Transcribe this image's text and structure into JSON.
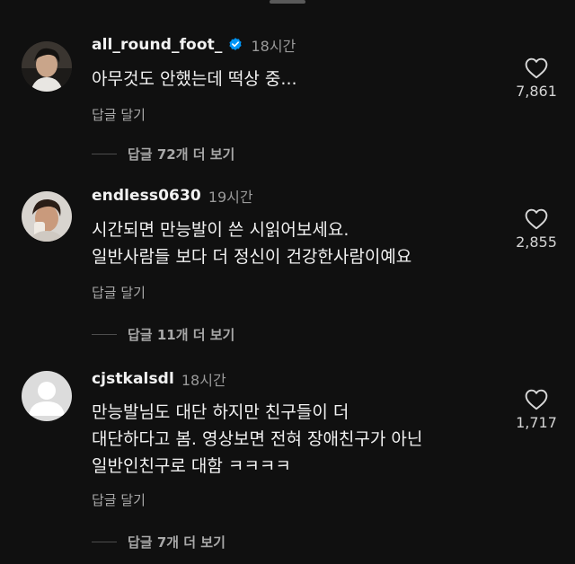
{
  "comments": [
    {
      "username": "all_round_foot_",
      "verified": true,
      "time": "18시간",
      "body": "아무것도 안했는데 떡상 중...",
      "reply_label": "답글 달기",
      "likes": "7,861",
      "view_replies": "답글 72개 더 보기"
    },
    {
      "username": "endless0630",
      "verified": false,
      "time": "19시간",
      "body": "시간되면 만능발이 쓴 시읽어보세요.\n일반사람들 보다 더 정신이 건강한사람이예요",
      "reply_label": "답글 달기",
      "likes": "2,855",
      "view_replies": "답글 11개 더 보기"
    },
    {
      "username": "cjstkalsdl",
      "verified": false,
      "time": "18시간",
      "body": "만능발님도 대단 하지만 친구들이 더\n대단하다고 봄. 영상보면 전혀 장애친구가 아닌\n일반인친구로 대함 ㅋㅋㅋㅋ",
      "reply_label": "답글 달기",
      "likes": "1,717",
      "view_replies": "답글 7개 더 보기"
    }
  ],
  "colors": {
    "background": "#101010",
    "verified_badge": "#0095f6",
    "muted_text": "#9a9a9a"
  },
  "icons": {
    "like": "heart-outline-icon",
    "verified": "verified-badge-icon"
  }
}
